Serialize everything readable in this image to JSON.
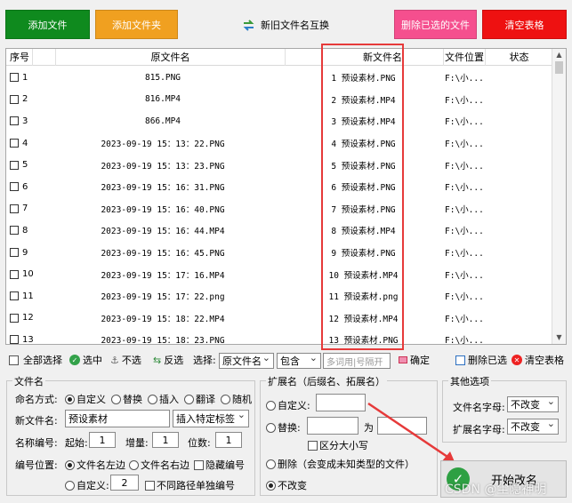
{
  "top_buttons": {
    "add_file": "添加文件",
    "add_folder": "添加文件夹",
    "swap_names": "新旧文件名互换",
    "delete_selected": "删除已选的文件",
    "clear_table": "清空表格"
  },
  "colors": {
    "add_file": "#0f8a1e",
    "add_folder": "#f0a020",
    "delete_selected": "#f54f8e",
    "clear_table": "#ee1111",
    "highlight_box": "#e63a3a"
  },
  "table": {
    "headers": {
      "seq": "序号",
      "original": "原文件名",
      "new": "新文件名",
      "location": "文件位置",
      "status": "状态"
    },
    "rows": [
      {
        "seq": "1",
        "original": "815.PNG",
        "new": "1 预设素材.PNG",
        "location": "F:\\小..."
      },
      {
        "seq": "2",
        "original": "816.MP4",
        "new": "2 预设素材.MP4",
        "location": "F:\\小..."
      },
      {
        "seq": "3",
        "original": "866.MP4",
        "new": "3 预设素材.MP4",
        "location": "F:\\小..."
      },
      {
        "seq": "4",
        "original": "2023-09-19 15：13：22.PNG",
        "new": "4 预设素材.PNG",
        "location": "F:\\小..."
      },
      {
        "seq": "5",
        "original": "2023-09-19 15：13：23.PNG",
        "new": "5 预设素材.PNG",
        "location": "F:\\小..."
      },
      {
        "seq": "6",
        "original": "2023-09-19 15：16：31.PNG",
        "new": "6 预设素材.PNG",
        "location": "F:\\小..."
      },
      {
        "seq": "7",
        "original": "2023-09-19 15：16：40.PNG",
        "new": "7 预设素材.PNG",
        "location": "F:\\小..."
      },
      {
        "seq": "8",
        "original": "2023-09-19 15：16：44.MP4",
        "new": "8 预设素材.MP4",
        "location": "F:\\小..."
      },
      {
        "seq": "9",
        "original": "2023-09-19 15：16：45.PNG",
        "new": "9 预设素材.PNG",
        "location": "F:\\小..."
      },
      {
        "seq": "10",
        "original": "2023-09-19 15：17：16.MP4",
        "new": "10 预设素材.MP4",
        "location": "F:\\小..."
      },
      {
        "seq": "11",
        "original": "2023-09-19 15：17：22.png",
        "new": "11 预设素材.png",
        "location": "F:\\小..."
      },
      {
        "seq": "12",
        "original": "2023-09-19 15：18：22.MP4",
        "new": "12 预设素材.MP4",
        "location": "F:\\小..."
      },
      {
        "seq": "13",
        "original": "2023-09-19 15：18：23.PNG",
        "new": "13 预设素材.PNG",
        "location": "F:\\小..."
      }
    ]
  },
  "selection_bar": {
    "select_all": "全部选择",
    "select": "选中",
    "deselect": "不选",
    "invert": "反选",
    "select_label": "选择:",
    "field_value": "原文件名",
    "match_value": "包含",
    "filter_placeholder": "多词用|号隔开",
    "confirm": "确定",
    "delete_selected": "删除已选",
    "clear_table": "清空表格"
  },
  "filename_group": {
    "title": "文件名",
    "naming_mode_label": "命名方式:",
    "modes": [
      "自定义",
      "替换",
      "插入",
      "翻译",
      "随机"
    ],
    "new_name_label": "新文件名:",
    "new_name_value": "预设素材",
    "insert_tag_value": "插入特定标签",
    "numbering_label": "名称编号:",
    "start_label": "起始:",
    "start_value": "1",
    "increment_label": "增量:",
    "increment_value": "1",
    "digits_label": "位数:",
    "digits_value": "1",
    "position_label": "编号位置:",
    "position_left": "文件名左边",
    "position_right": "文件名右边",
    "hide_number": "隐藏编号",
    "custom": "自定义:",
    "custom_value": "2",
    "separate_paths": "不同路径单独编号"
  },
  "extension_group": {
    "title": "扩展名（后缀名、拓展名）",
    "custom": "自定义:",
    "replace": "替换:",
    "to": "为",
    "case_sensitive": "区分大小写",
    "delete": "删除（会变成未知类型的文件）",
    "unchanged": "不改变"
  },
  "other_group": {
    "title": "其他选项",
    "filename_case_label": "文件名字母:",
    "filename_case_value": "不改变",
    "ext_case_label": "扩展名字母:",
    "ext_case_value": "不改变"
  },
  "start_button": "开始改名",
  "watermark": "CSDN @尘隐神明"
}
